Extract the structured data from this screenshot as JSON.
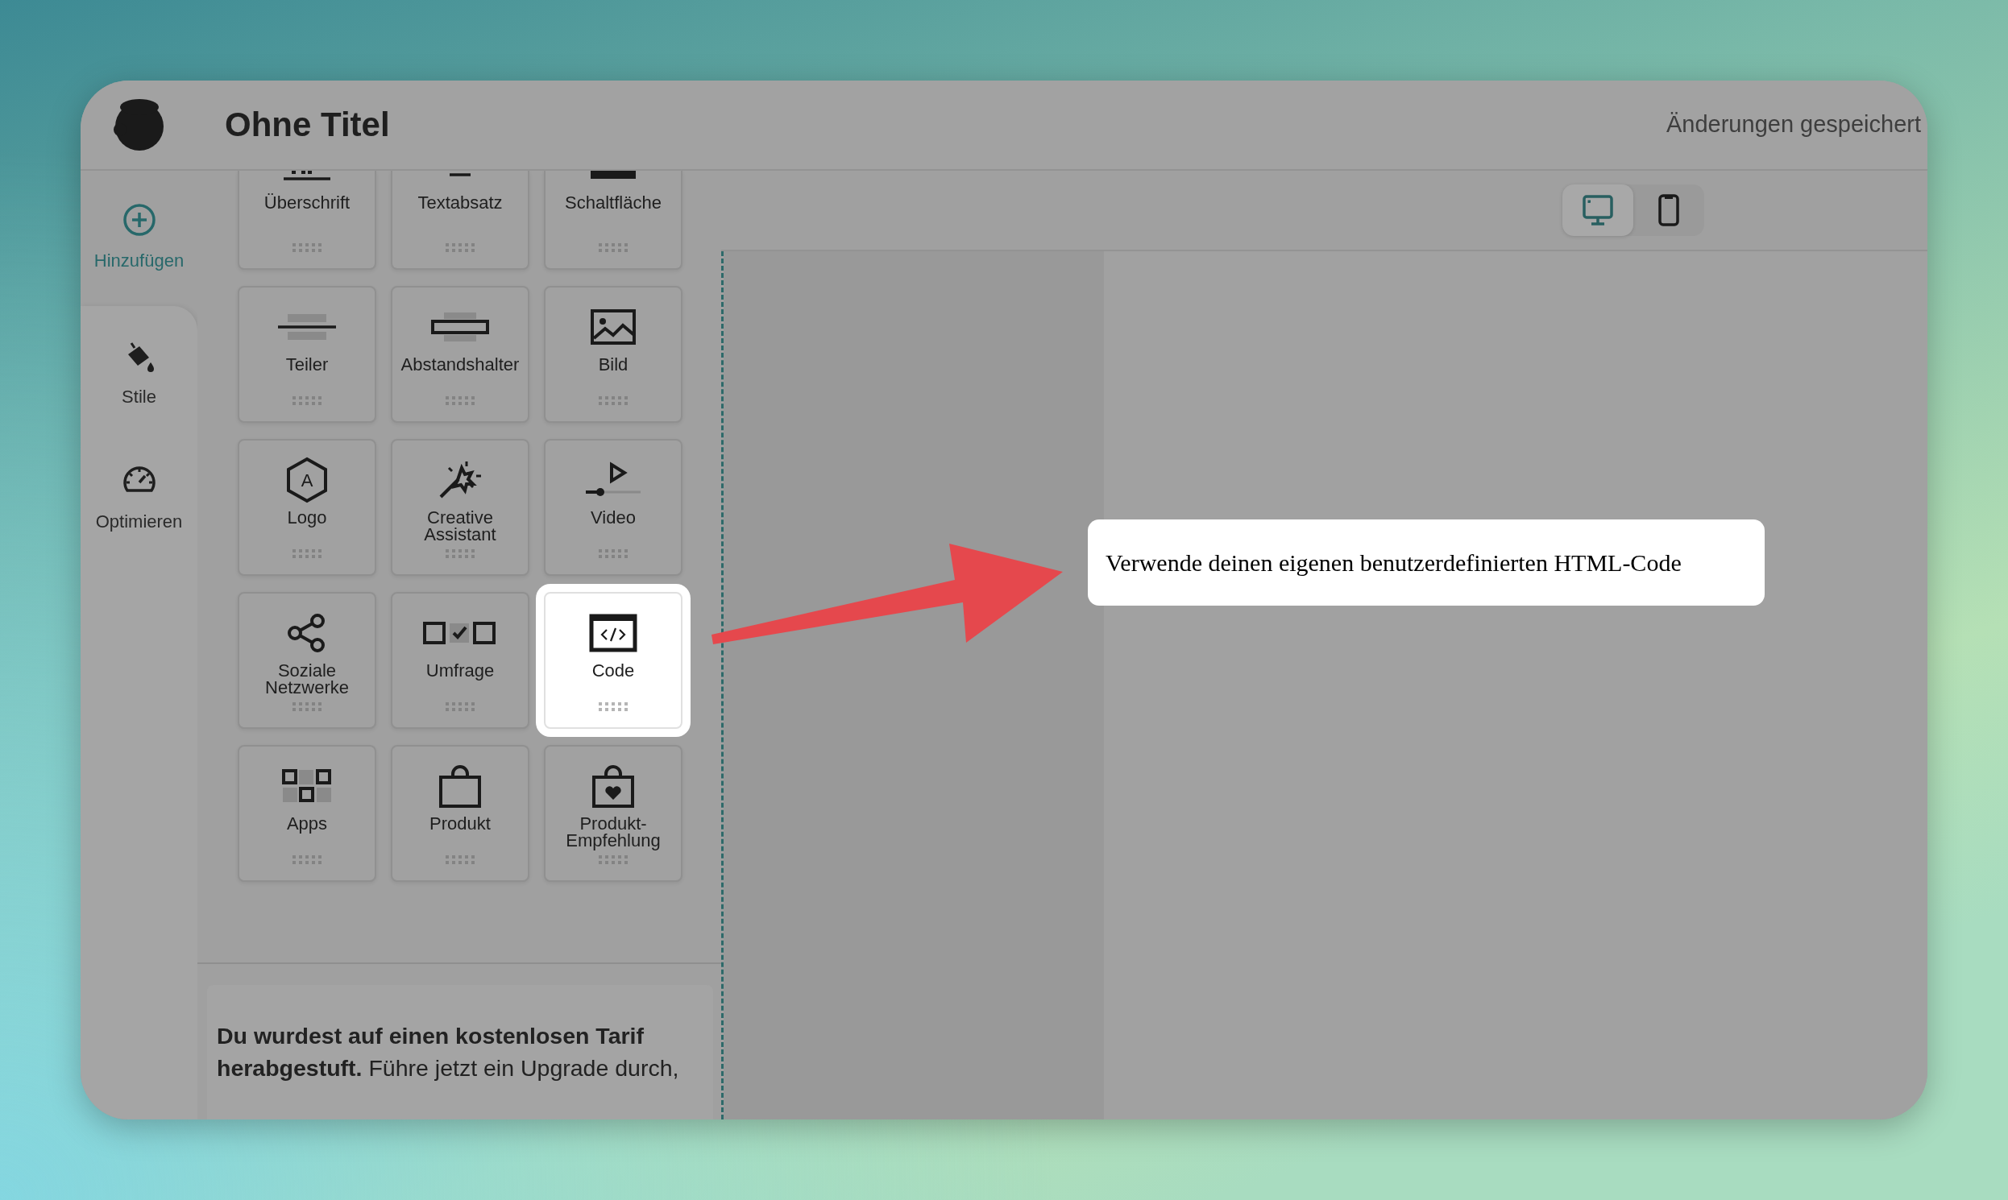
{
  "header": {
    "title": "Ohne Titel",
    "status": "Änderungen gespeichert"
  },
  "sidebar": {
    "items": [
      {
        "label": "Hinzufügen",
        "selected": true
      },
      {
        "label": "Stile",
        "selected": false
      },
      {
        "label": "Optimieren",
        "selected": false
      }
    ]
  },
  "blocks": [
    {
      "label": "Überschrift",
      "selected": false
    },
    {
      "label": "Textabsatz",
      "selected": false
    },
    {
      "label": "Schaltfläche",
      "selected": false
    },
    {
      "label": "Teiler",
      "selected": false
    },
    {
      "label": "Abstandshalter",
      "selected": false
    },
    {
      "label": "Bild",
      "selected": false
    },
    {
      "label": "Logo",
      "selected": false,
      "icon_letter": "A"
    },
    {
      "label": "Creative Assistant",
      "selected": false
    },
    {
      "label": "Video",
      "selected": false
    },
    {
      "label": "Soziale Netzwerke",
      "selected": false
    },
    {
      "label": "Umfrage",
      "selected": false
    },
    {
      "label": "Code",
      "selected": true
    },
    {
      "label": "Apps",
      "selected": false
    },
    {
      "label": "Produkt",
      "selected": false
    },
    {
      "label": "Produkt-Empfehlung",
      "selected": false
    }
  ],
  "promo": {
    "text": "**Du wurdest auf einen kostenlosen Tarif herabgestuft.** Führe jetzt ein Upgrade durch,"
  },
  "device_toggle": [
    {
      "selected": true
    },
    {
      "selected": false
    }
  ],
  "callout": {
    "text": "Verwende deinen eigenen benutzerdefinierten HTML-Code"
  }
}
